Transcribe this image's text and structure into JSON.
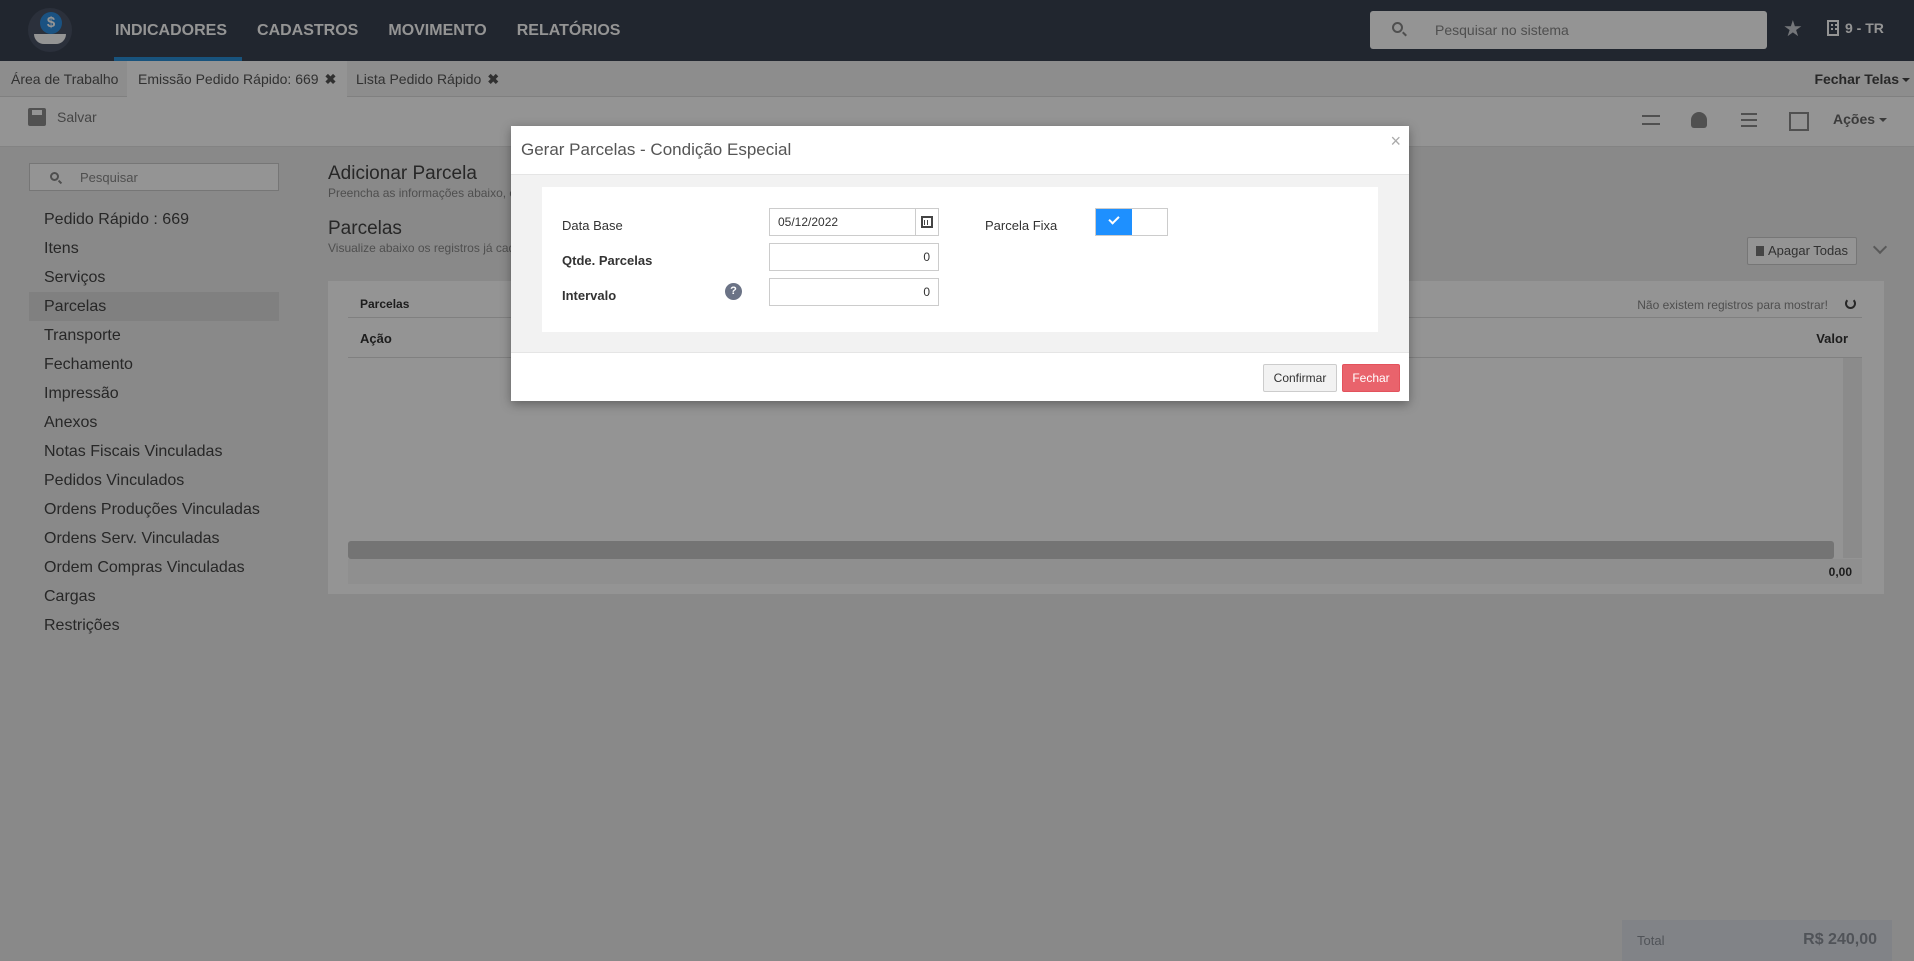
{
  "nav": {
    "items": [
      {
        "label": "INDICADORES",
        "active": true
      },
      {
        "label": "CADASTROS"
      },
      {
        "label": "MOVIMENTO"
      },
      {
        "label": "RELATÓRIOS"
      }
    ],
    "search_placeholder": "Pesquisar no sistema",
    "company": "9 - TR",
    "logo_symbol": "$"
  },
  "tabs": [
    {
      "label": "Área de Trabalho"
    },
    {
      "label": "Emissão Pedido Rápido: 669",
      "close": "✖"
    },
    {
      "label": "Lista Pedido Rápido",
      "close": "✖"
    }
  ],
  "tabs_close_all": "Fechar Telas",
  "toolbar": {
    "save_label": "Salvar",
    "actions_label": "Ações"
  },
  "sidebar": {
    "search_placeholder": "Pesquisar",
    "items": [
      {
        "label": "Pedido Rápido : 669"
      },
      {
        "label": "Itens"
      },
      {
        "label": "Serviços"
      },
      {
        "label": "Parcelas",
        "active": true
      },
      {
        "label": "Transporte"
      },
      {
        "label": "Fechamento"
      },
      {
        "label": "Impressão"
      },
      {
        "label": "Anexos"
      },
      {
        "label": "Notas Fiscais Vinculadas"
      },
      {
        "label": "Pedidos Vinculados"
      },
      {
        "label": "Ordens Produções Vinculadas"
      },
      {
        "label": "Ordens Serv. Vinculadas"
      },
      {
        "label": "Ordem Compras Vinculadas"
      },
      {
        "label": "Cargas"
      },
      {
        "label": "Restrições"
      }
    ]
  },
  "main": {
    "add_title": "Adicionar Parcela",
    "add_subtitle": "Preencha as informações abaixo, c",
    "list_title": "Parcelas",
    "list_subtitle": "Visualize abaixo os registros já cad",
    "delete_all": "Apagar Todas",
    "grid": {
      "header": "Parcelas",
      "empty_message": "Não existem registros para mostrar!",
      "col_action": "Ação",
      "col_value": "Valor",
      "footer_sum": "0,00"
    }
  },
  "total": {
    "label": "Total",
    "value": "R$ 240,00"
  },
  "modal": {
    "title": "Gerar Parcelas - Condição Especial",
    "close_symbol": "×",
    "fields": {
      "data_base_label": "Data Base",
      "data_base_value": "05/12/2022",
      "qtde_label": "Qtde. Parcelas",
      "qtde_value": "0",
      "intervalo_label": "Intervalo",
      "intervalo_value": "0",
      "help_symbol": "?",
      "parcela_fixa_label": "Parcela Fixa",
      "parcela_fixa_on": true
    },
    "buttons": {
      "confirm": "Confirmar",
      "close": "Fechar"
    }
  },
  "colors": {
    "navbar": "#3a4252",
    "accent": "#2a8fd8",
    "toggle_on": "#1e90ff",
    "danger": "#e9636c"
  }
}
